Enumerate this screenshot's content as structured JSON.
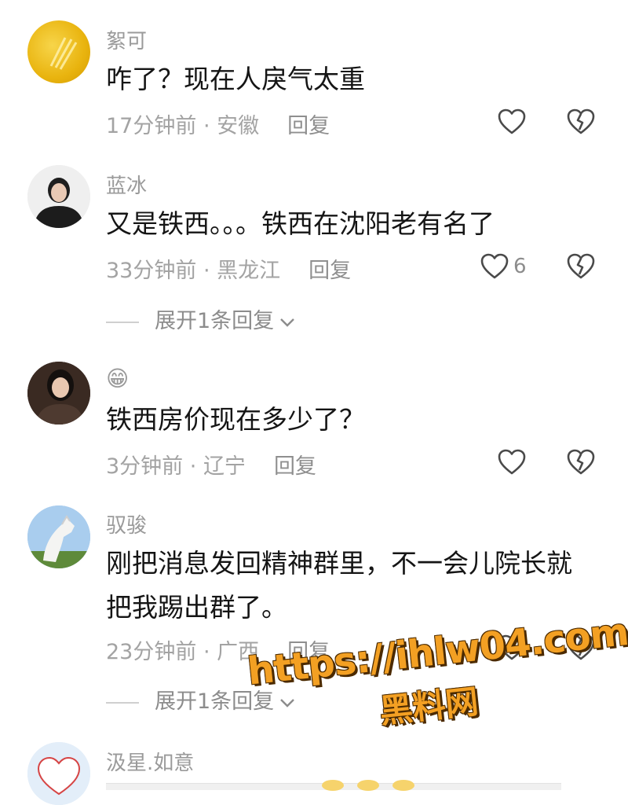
{
  "comments": [
    {
      "name": "絮可",
      "text": [
        "咋了？现在人戾气太重"
      ],
      "time": "17分钟前",
      "location": "安徽",
      "reply_label": "回复",
      "likes": ""
    },
    {
      "name": "蓝冰",
      "text": [
        "又是铁西。。。铁西在沈阳老有名了"
      ],
      "time": "33分钟前",
      "location": "黑龙江",
      "reply_label": "回复",
      "likes": "6",
      "expand_label": "展开1条回复"
    },
    {
      "name": "😁",
      "text": [
        "铁西房价现在多少了？"
      ],
      "time": "3分钟前",
      "location": "辽宁",
      "reply_label": "回复",
      "likes": ""
    },
    {
      "name": "驭骏",
      "text": [
        "刚把消息发回精神群里，不一会儿院长就",
        "把我踢出群了。"
      ],
      "time": "23分钟前",
      "location": "广西",
      "reply_label": "回复",
      "likes": "",
      "expand_label": "展开1条回复"
    },
    {
      "name": "汲星.如意"
    }
  ],
  "meta_separator": " · ",
  "watermark": {
    "url": "https://ihlw04.com",
    "label": "黑料网"
  },
  "icons": {
    "like": "heart-outline-icon",
    "dislike": "broken-heart-icon",
    "expand": "chevron-down-icon"
  },
  "colors": {
    "name": "#9a9a9a",
    "text": "#151515",
    "meta": "#a3a3a3",
    "watermark": "#f3a023"
  }
}
